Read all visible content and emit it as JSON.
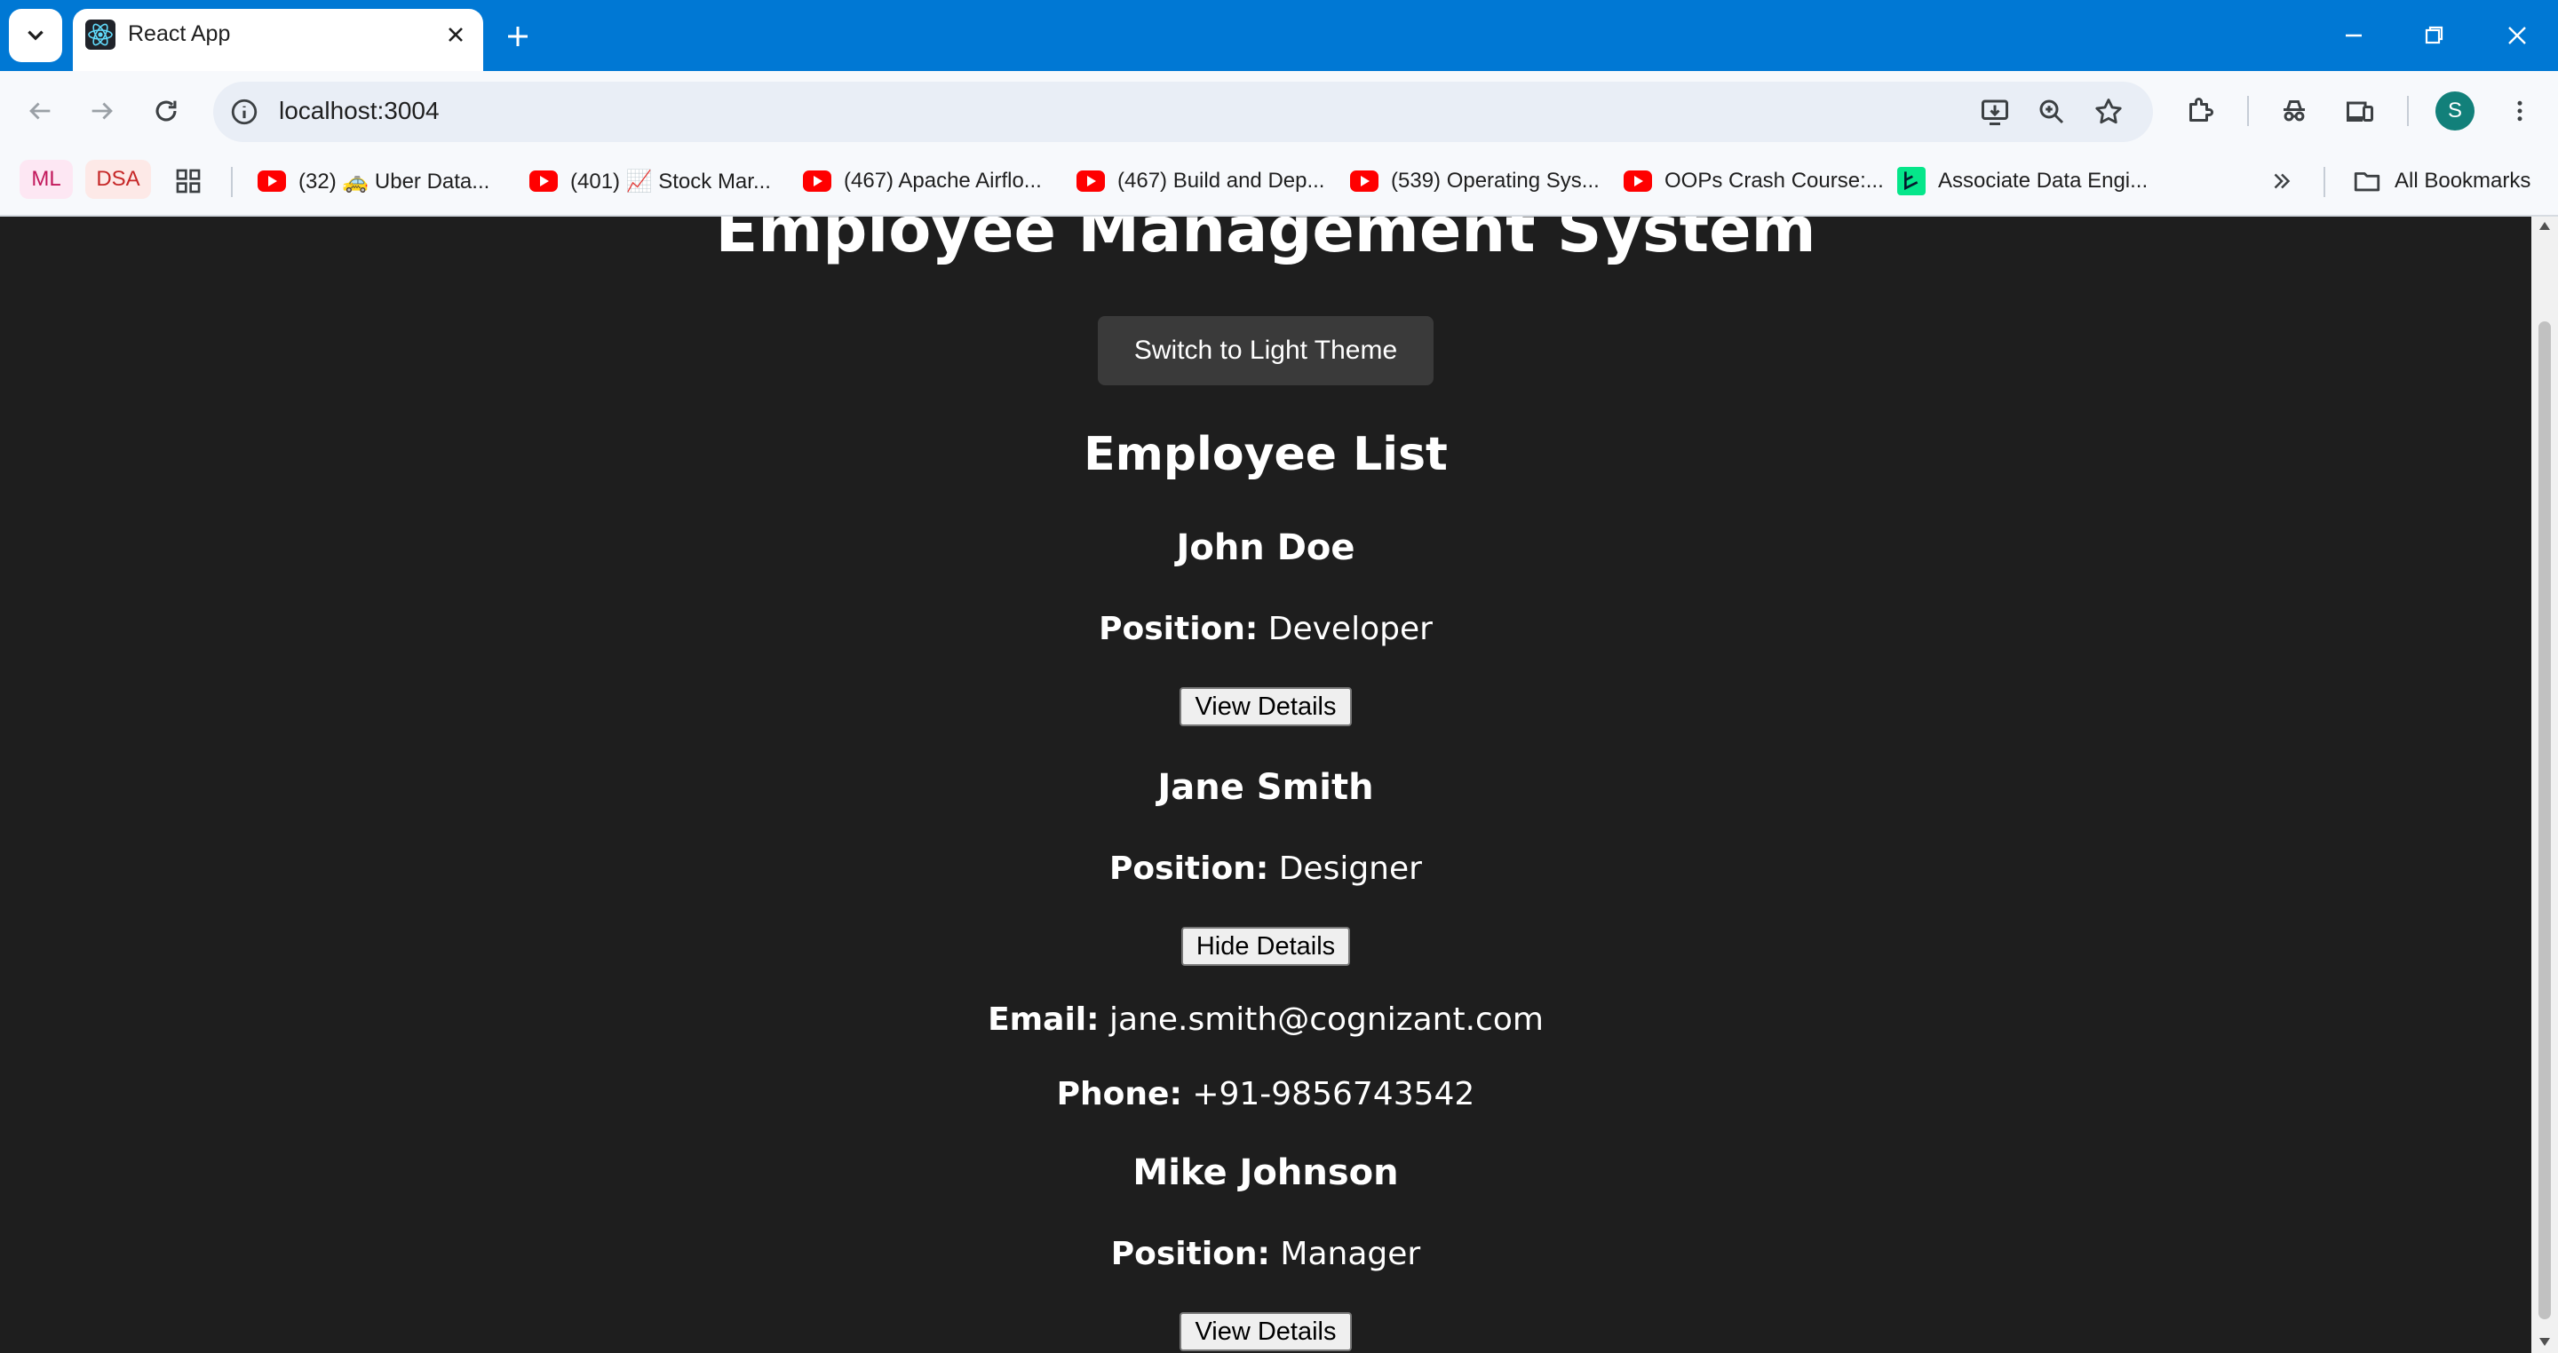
{
  "browser": {
    "tab_title": "React App",
    "url": "localhost:3004",
    "profile_initial": "S",
    "bookmarks": [
      {
        "label": "ML",
        "type": "chip"
      },
      {
        "label": "DSA",
        "type": "chip"
      },
      {
        "label": "(32) 🚕 Uber Data...",
        "type": "youtube"
      },
      {
        "label": "(401) 📈 Stock Mar...",
        "type": "youtube"
      },
      {
        "label": "(467) Apache Airflo...",
        "type": "youtube"
      },
      {
        "label": "(467) Build and Dep...",
        "type": "youtube"
      },
      {
        "label": "(539) Operating Sys...",
        "type": "youtube"
      },
      {
        "label": "OOPs Crash Course:...",
        "type": "youtube"
      },
      {
        "label": "Associate Data Engi...",
        "type": "site"
      }
    ],
    "all_bookmarks_label": "All Bookmarks",
    "colors": {
      "titlebar": "#0078d4",
      "page_bg": "#1e1e1e",
      "avatar": "#12807a"
    }
  },
  "app": {
    "title": "Employee Management System",
    "theme_button": "Switch to Light Theme",
    "list_heading": "Employee List",
    "position_label": "Position:",
    "email_label": "Email:",
    "phone_label": "Phone:",
    "employees": [
      {
        "name": "John Doe",
        "position": "Developer",
        "button": "View Details"
      },
      {
        "name": "Jane Smith",
        "position": "Designer",
        "button": "Hide Details",
        "email": "jane.smith@cognizant.com",
        "phone": "+91-9856743542"
      },
      {
        "name": "Mike Johnson",
        "position": "Manager",
        "button": "View Details"
      }
    ]
  }
}
